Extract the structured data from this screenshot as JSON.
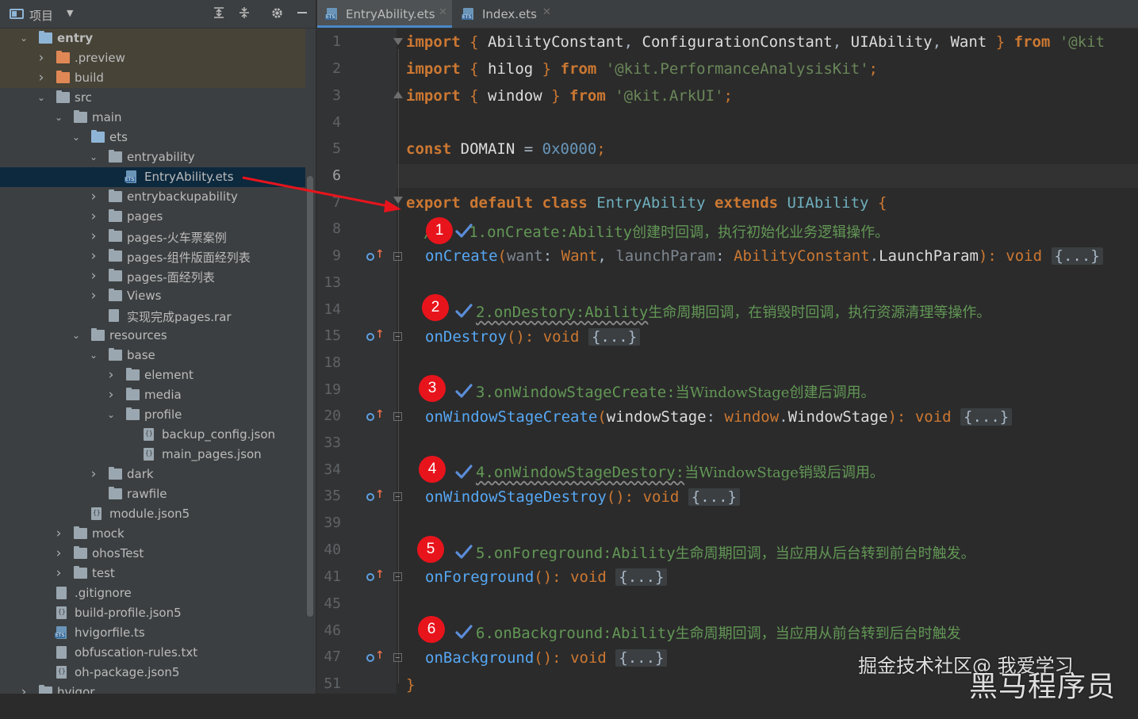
{
  "sidebar": {
    "title": "项目",
    "tree": [
      {
        "label": "entry",
        "depth": 0,
        "open": true,
        "kind": "folder-blue",
        "state": "entry"
      },
      {
        "label": ".preview",
        "depth": 1,
        "open": false,
        "kind": "folder-orange",
        "state": "entry"
      },
      {
        "label": "build",
        "depth": 1,
        "open": false,
        "kind": "folder-orange",
        "state": "entry"
      },
      {
        "label": "src",
        "depth": 1,
        "open": true,
        "kind": "folder"
      },
      {
        "label": "main",
        "depth": 2,
        "open": true,
        "kind": "folder"
      },
      {
        "label": "ets",
        "depth": 3,
        "open": true,
        "kind": "folder-blue"
      },
      {
        "label": "entryability",
        "depth": 4,
        "open": true,
        "kind": "folder"
      },
      {
        "label": "EntryAbility.ets",
        "depth": 5,
        "kind": "file-ets",
        "state": "selected"
      },
      {
        "label": "entrybackupability",
        "depth": 4,
        "open": false,
        "kind": "folder"
      },
      {
        "label": "pages",
        "depth": 4,
        "open": false,
        "kind": "folder"
      },
      {
        "label": "pages-火车票案例",
        "depth": 4,
        "open": false,
        "kind": "folder"
      },
      {
        "label": "pages-组件版面经列表",
        "depth": 4,
        "open": false,
        "kind": "folder"
      },
      {
        "label": "pages-面经列表",
        "depth": 4,
        "open": false,
        "kind": "folder"
      },
      {
        "label": "Views",
        "depth": 4,
        "open": false,
        "kind": "folder"
      },
      {
        "label": "实现完成pages.rar",
        "depth": 4,
        "kind": "file"
      },
      {
        "label": "resources",
        "depth": 3,
        "open": true,
        "kind": "folder"
      },
      {
        "label": "base",
        "depth": 4,
        "open": true,
        "kind": "folder"
      },
      {
        "label": "element",
        "depth": 5,
        "open": false,
        "kind": "folder"
      },
      {
        "label": "media",
        "depth": 5,
        "open": false,
        "kind": "folder"
      },
      {
        "label": "profile",
        "depth": 5,
        "open": true,
        "kind": "folder"
      },
      {
        "label": "backup_config.json",
        "depth": 6,
        "kind": "file-json"
      },
      {
        "label": "main_pages.json",
        "depth": 6,
        "kind": "file-json"
      },
      {
        "label": "dark",
        "depth": 4,
        "open": false,
        "kind": "folder"
      },
      {
        "label": "rawfile",
        "depth": 4,
        "kind": "folder"
      },
      {
        "label": "module.json5",
        "depth": 3,
        "kind": "file-json"
      },
      {
        "label": "mock",
        "depth": 2,
        "open": false,
        "kind": "folder"
      },
      {
        "label": "ohosTest",
        "depth": 2,
        "open": false,
        "kind": "folder"
      },
      {
        "label": "test",
        "depth": 2,
        "open": false,
        "kind": "folder"
      },
      {
        "label": ".gitignore",
        "depth": 1,
        "kind": "file"
      },
      {
        "label": "build-profile.json5",
        "depth": 1,
        "kind": "file-json"
      },
      {
        "label": "hvigorfile.ts",
        "depth": 1,
        "kind": "file-ets"
      },
      {
        "label": "obfuscation-rules.txt",
        "depth": 1,
        "kind": "file"
      },
      {
        "label": "oh-package.json5",
        "depth": 1,
        "kind": "file-json"
      },
      {
        "label": "hvigor",
        "depth": 0,
        "open": false,
        "kind": "folder"
      }
    ]
  },
  "tabs": [
    {
      "label": "EntryAbility.ets",
      "active": true
    },
    {
      "label": "Index.ets",
      "active": false
    }
  ],
  "editor": {
    "line_numbers": [
      "1",
      "2",
      "3",
      "4",
      "5",
      "6",
      "7",
      "8",
      "9",
      "13",
      "14",
      "15",
      "18",
      "19",
      "20",
      "33",
      "34",
      "35",
      "39",
      "40",
      "41",
      "45",
      "46",
      "47",
      "51"
    ],
    "current_line": "6",
    "code": {
      "l1": [
        "import",
        "{",
        "AbilityConstant",
        ",",
        "ConfigurationConstant",
        ",",
        "UIAbility",
        ",",
        "Want",
        "}",
        "from",
        "'@kit"
      ],
      "l2": [
        "import",
        "{",
        "hilog",
        "}",
        "from",
        "'@kit.PerformanceAnalysisKit'",
        ";"
      ],
      "l3": [
        "import",
        "{",
        "window",
        "}",
        "from",
        "'@kit.ArkUI'",
        ";"
      ],
      "l5": [
        "const",
        "DOMAIN",
        "=",
        "0x0000",
        ";"
      ],
      "l7": [
        "export",
        "default",
        "class",
        "EntryAbility",
        "extends",
        "UIAbility",
        "{"
      ],
      "l9": [
        "onCreate",
        "(",
        "want",
        ":",
        "Want",
        ",",
        "launchParam",
        ":",
        "AbilityConstant",
        ".",
        "LaunchParam",
        "):",
        "void",
        "{...}"
      ],
      "l15": [
        "onDestroy",
        "():",
        "void",
        "{...}"
      ],
      "l20": [
        "onWindowStageCreate",
        "(",
        "windowStage",
        ":",
        "window",
        ".",
        "WindowStage",
        "):",
        "void",
        "{...}"
      ],
      "l35": [
        "onWindowStageDestroy",
        "():",
        "void",
        "{...}"
      ],
      "l41": [
        "onForeground",
        "():",
        "void",
        "{...}"
      ],
      "l47": [
        "onBackground",
        "():",
        "void",
        "{...}"
      ],
      "l51": "}"
    },
    "comments": [
      {
        "num": "1",
        "code": "1.onCreate:Ability",
        "text": "创建时回调，执行初始化业务逻辑操作。",
        "prefix": "/"
      },
      {
        "num": "2",
        "code": "2.onDestory:Ability",
        "text": "生命周期回调，在销毁时回调，执行资源清理等操作。"
      },
      {
        "num": "3",
        "code": "3.onWindowStageCreate:",
        "text": "当WindowStage创建后调用。"
      },
      {
        "num": "4",
        "code": "4.onWindowStageDestory:",
        "text": "当WindowStage销毁后调用。"
      },
      {
        "num": "5",
        "code": "5.onForeground:Ability",
        "text": "生命周期回调，当应用从后台转到前台时触发。"
      },
      {
        "num": "6",
        "code": "6.onBackground:Ability",
        "text": "生命周期回调，当应用从前台转到后台时触发"
      }
    ]
  },
  "watermark": {
    "line1": "掘金技术社区@ 我爱学习",
    "line2": "黑马程序员"
  },
  "colors": {
    "badge": "#e8141c",
    "arrow": "#e8141c",
    "selection": "#0d293e"
  }
}
